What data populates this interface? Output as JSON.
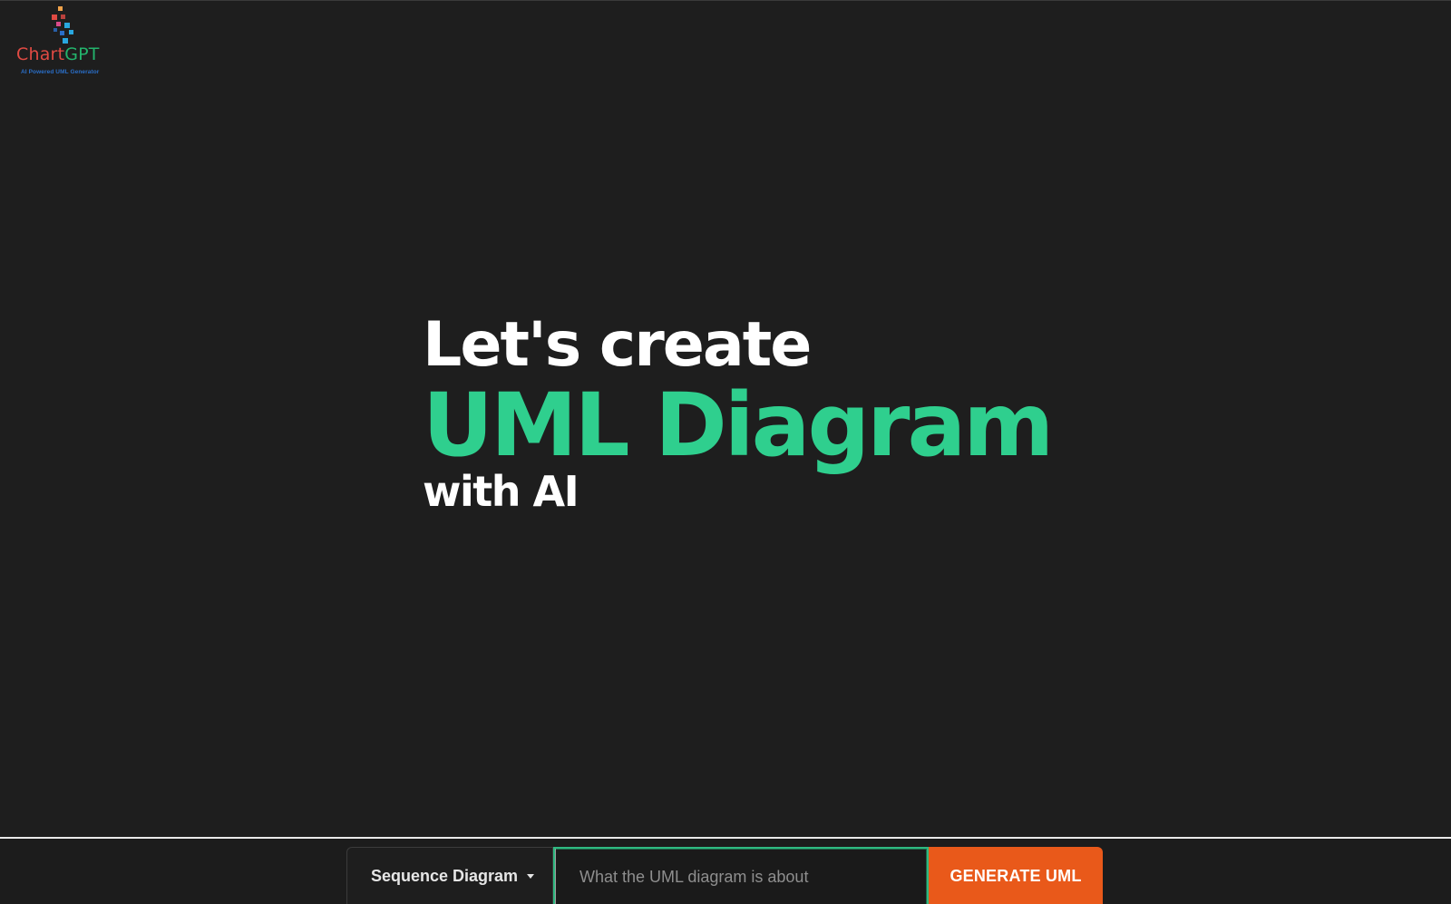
{
  "logo": {
    "name_part1": "Chart",
    "name_part2": "GPT",
    "tagline": "AI Powered UML Generator",
    "colors": [
      "#e04a43",
      "#23b36c",
      "#2a6fc9",
      "#29a8e0",
      "#f0a24a"
    ]
  },
  "hero": {
    "line1": "Let's create",
    "line2": "UML Diagram",
    "line3": "with AI",
    "accent_color": "#2fcf8e"
  },
  "controls": {
    "diagram_type": "Sequence Diagram",
    "prompt_placeholder": "What the UML diagram is about",
    "prompt_value": "",
    "generate_label": "GENERATE UML",
    "button_color": "#e9591a",
    "focus_color": "#2fb981"
  }
}
